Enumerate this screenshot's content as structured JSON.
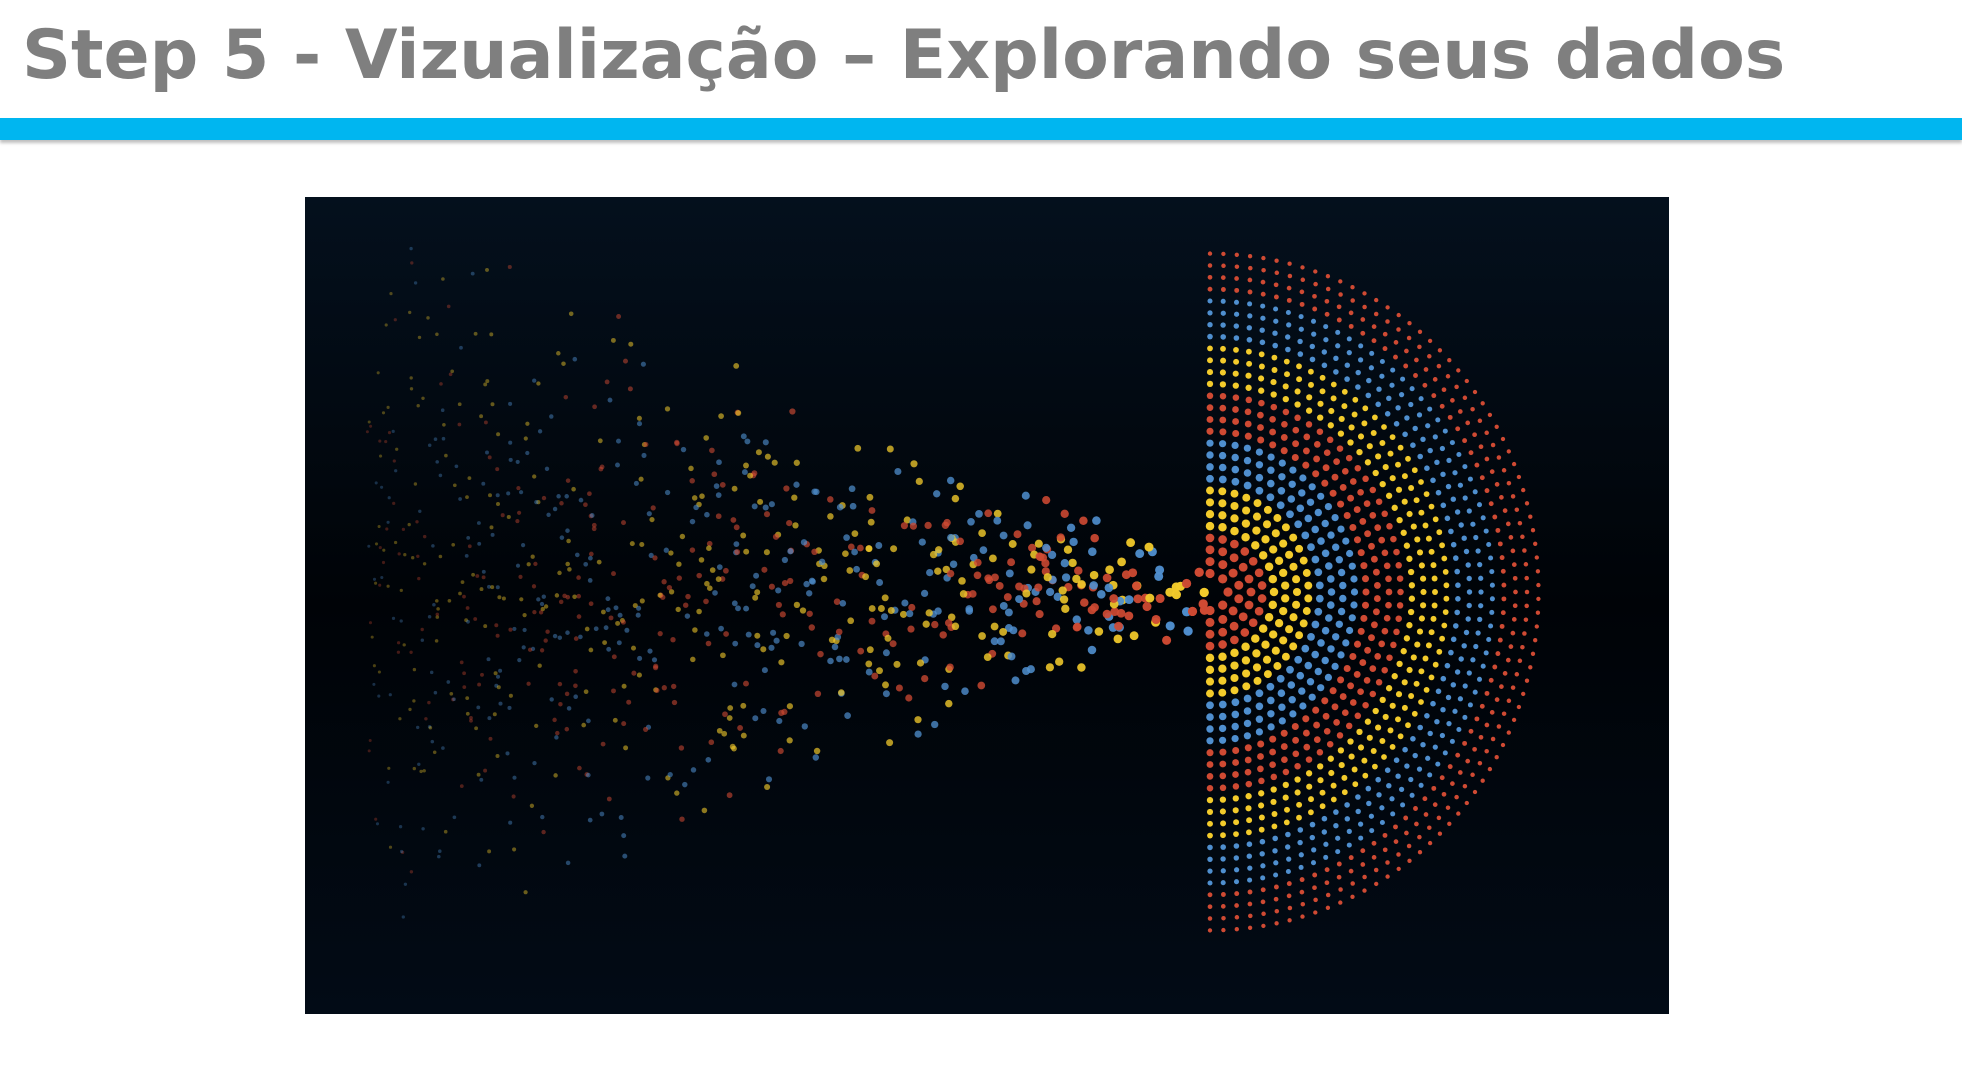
{
  "slide": {
    "title": "Step 5 - Vizualização – Explorando seus dados"
  },
  "visualization": {
    "colors": {
      "red": "#cf4a33",
      "yellow": "#f3cb2b",
      "blue": "#4f8fcf",
      "background_top": "#04101d",
      "background_bottom": "#020b16",
      "accent_rule": "#00b6f0",
      "title": "#7f7f7f"
    }
  }
}
